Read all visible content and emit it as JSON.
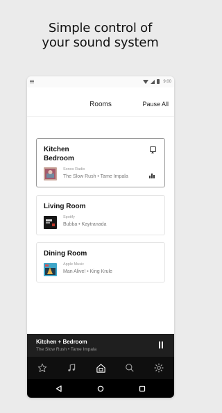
{
  "headline": {
    "line1": "Simple control of",
    "line2": "your sound system"
  },
  "status_bar": {
    "time": "9:00"
  },
  "header": {
    "title": "Rooms",
    "pause_all": "Pause All"
  },
  "rooms": [
    {
      "name_line1": "Kitchen",
      "name_line2": "Bedroom",
      "service": "Sonos Radio",
      "track": "The Slow Rush • Tame Impala",
      "selected": true
    },
    {
      "name_line1": "Living Room",
      "service": "Spotify",
      "track": "Bubba • Kaytranada",
      "selected": false
    },
    {
      "name_line1": "Dining Room",
      "service": "Apple Music",
      "track": "Man Alive! • King Krule",
      "selected": false
    }
  ],
  "now_playing": {
    "room": "Kitchen + Bedroom",
    "track": "The Slow Rush • Tame Impala"
  },
  "tabs": [
    "star-icon",
    "music-note-icon",
    "home-icon",
    "search-icon",
    "gear-icon"
  ],
  "colors": {
    "accent": "#1f1f1f",
    "tabbar": "#0f0f0f",
    "background": "#ebebeb"
  }
}
